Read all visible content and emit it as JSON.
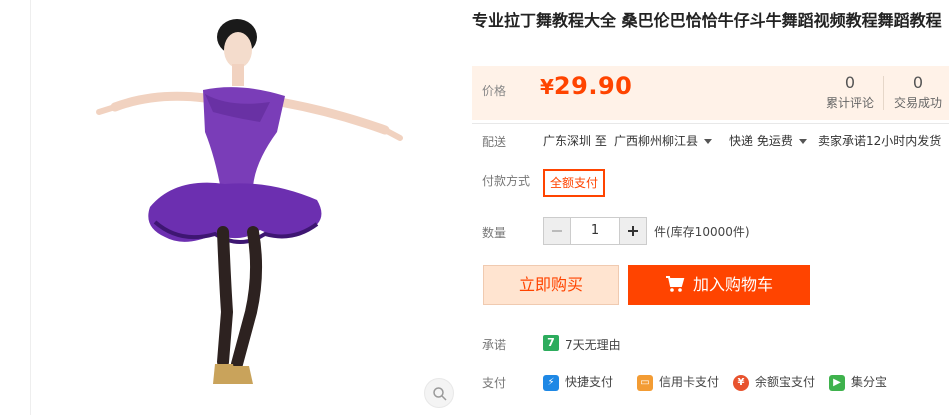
{
  "product": {
    "title": "专业拉丁舞教程大全 桑巴伦巴恰恰牛仔斗牛舞蹈视频教程舞蹈教程"
  },
  "price": {
    "label": "价格",
    "currency": "¥",
    "value": "29.90",
    "stats": [
      {
        "value": "0",
        "label": "累计评论"
      },
      {
        "value": "0",
        "label": "交易成功"
      }
    ]
  },
  "shipping": {
    "label": "配送",
    "from": "广东深圳 至",
    "to": "广西柳州柳江县",
    "method": "快递 免运费",
    "promise": "卖家承诺12小时内发货"
  },
  "payment_method": {
    "label": "付款方式",
    "selected": "全额支付"
  },
  "quantity": {
    "label": "数量",
    "value": "1",
    "note": "件(库存10000件)"
  },
  "actions": {
    "buy_now": "立即购买",
    "add_cart": "加入购物车"
  },
  "promise": {
    "label": "承诺",
    "icon_text": "7",
    "text": "7天无理由"
  },
  "payment": {
    "label": "支付",
    "options": [
      "快捷支付",
      "信用卡支付",
      "余额宝支付",
      "集分宝"
    ]
  },
  "colors": {
    "accent": "#ff4400",
    "price_bg": "#fff2e8",
    "buy_now_bg": "#ffe4d0",
    "promise_green": "#2dac5d"
  },
  "icons": [
    "zoom-icon",
    "caret-down-icon",
    "minus-icon",
    "plus-icon",
    "cart-icon",
    "seven-day-icon",
    "quick-pay-icon",
    "credit-card-icon",
    "yuebao-icon",
    "jifenbao-icon"
  ]
}
